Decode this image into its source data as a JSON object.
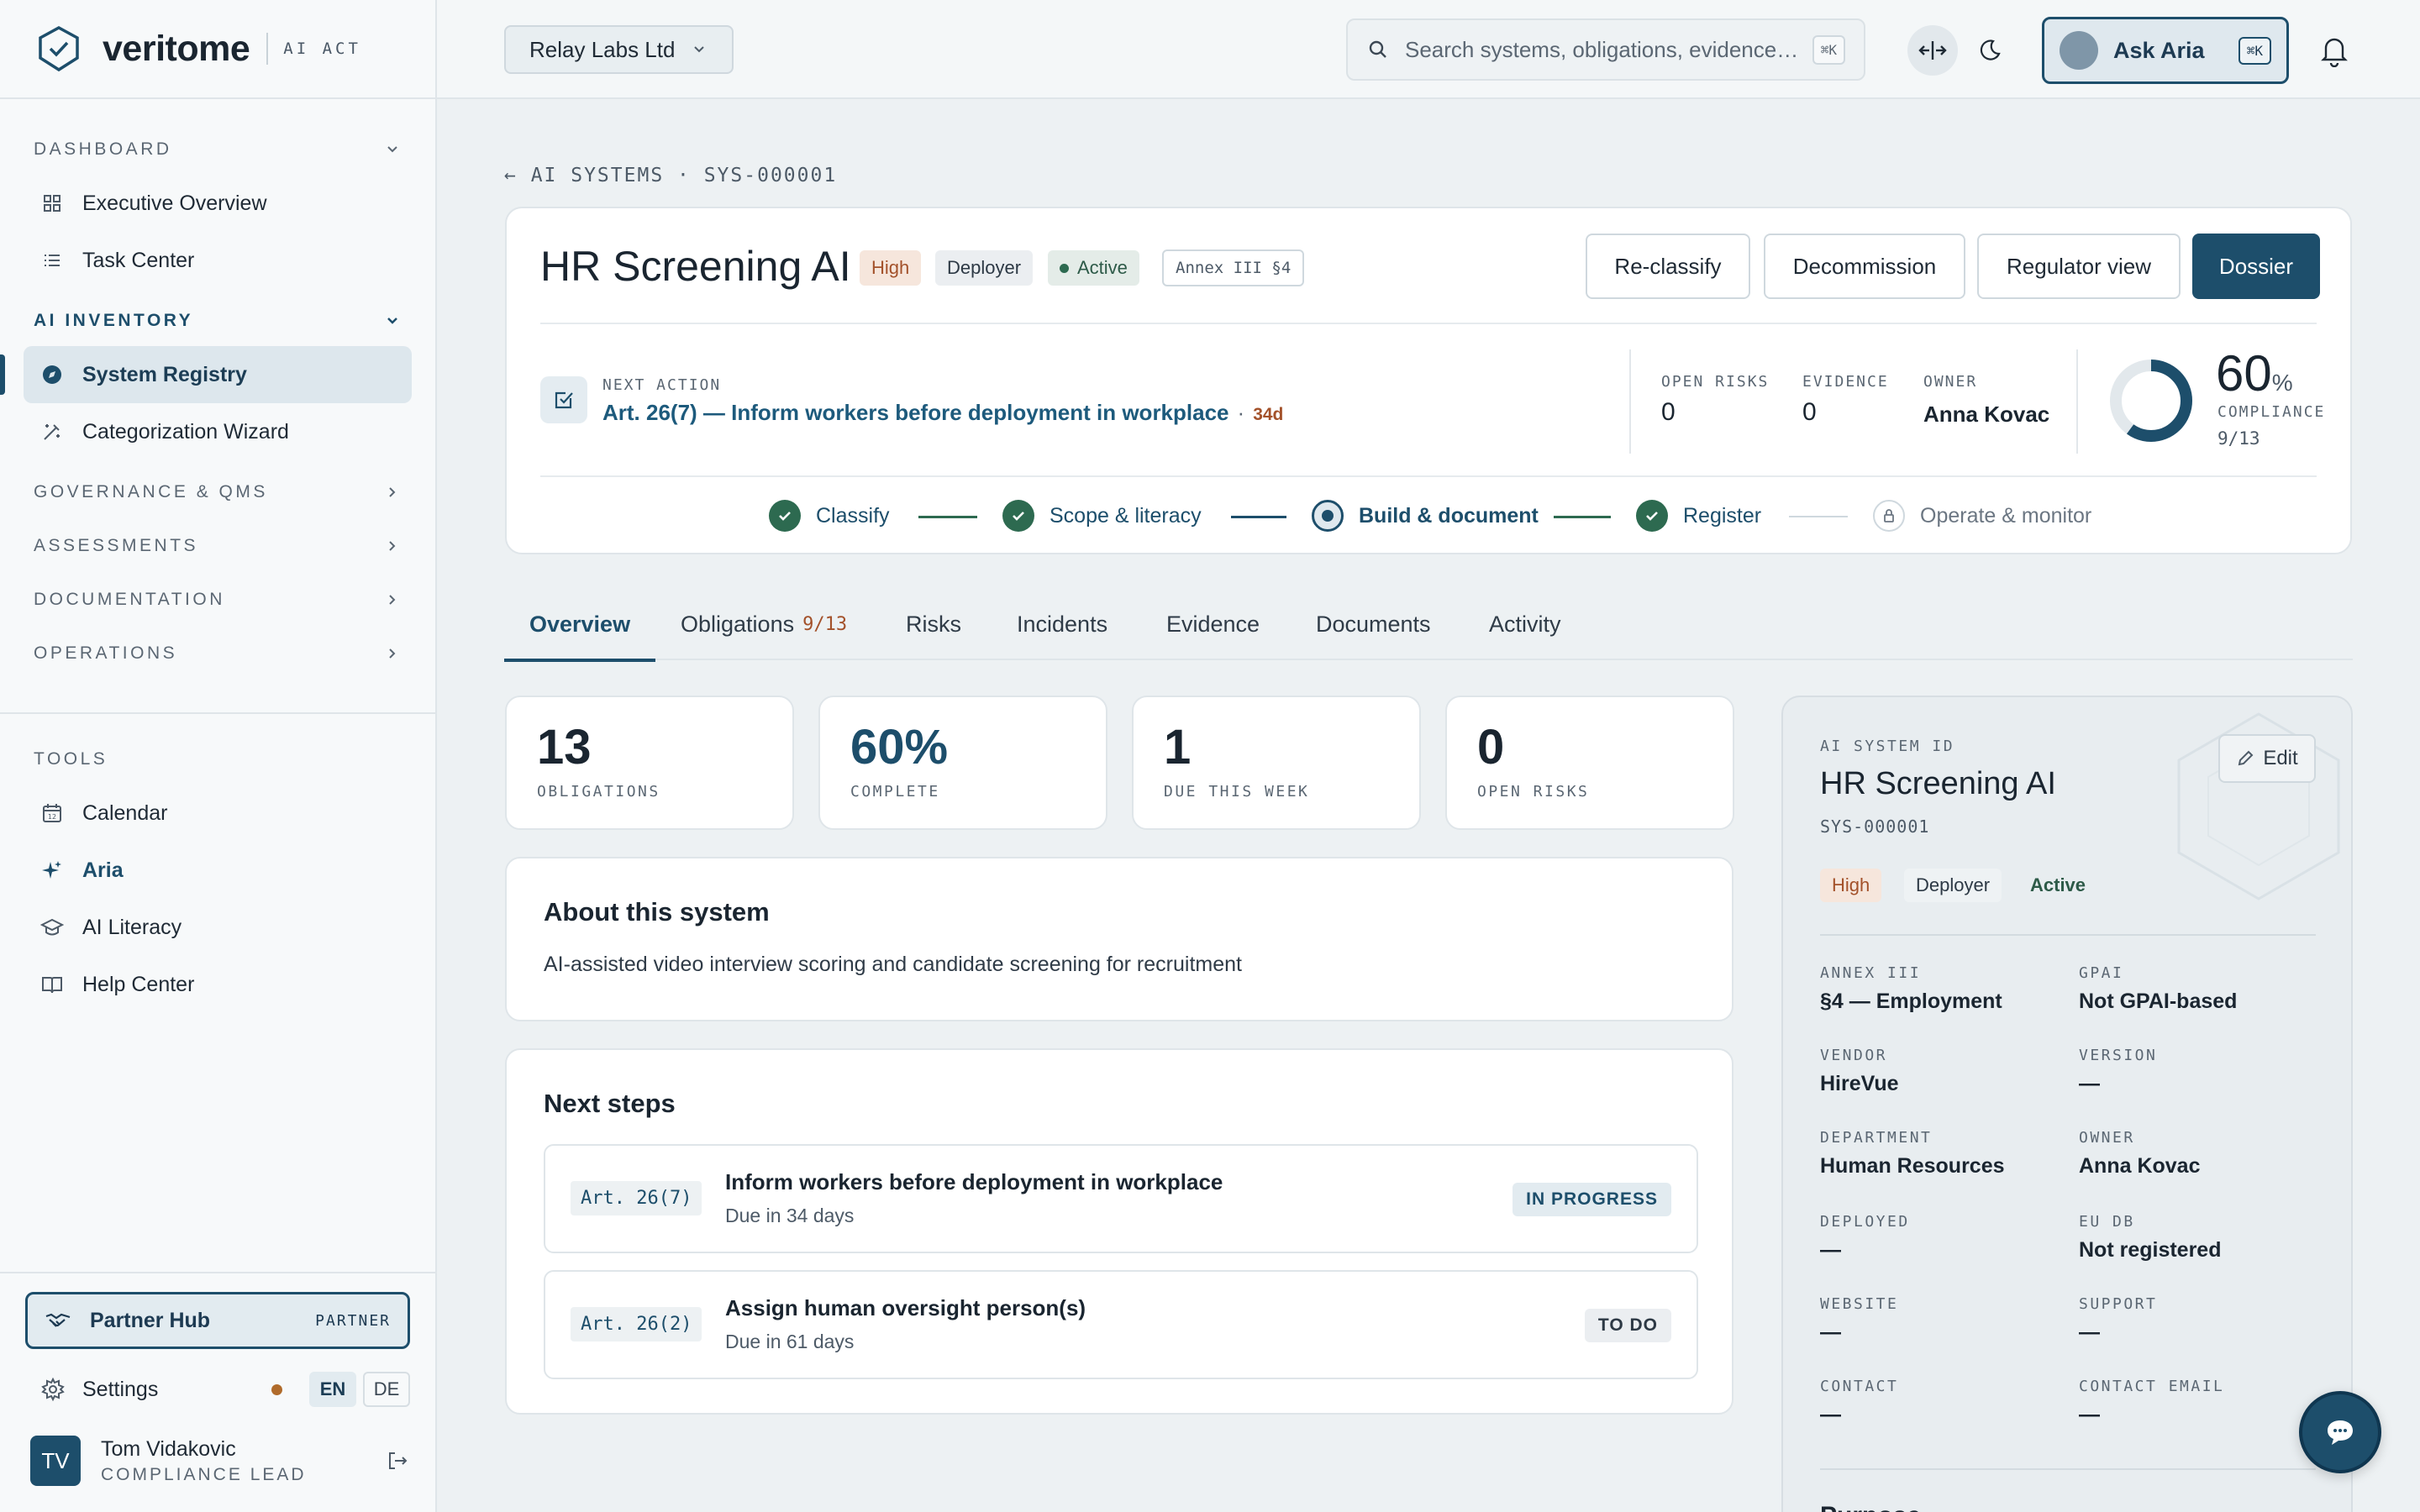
{
  "brand": {
    "name": "veritome",
    "tag": "AI ACT"
  },
  "sidebar": {
    "dashboard": "DASHBOARD",
    "executive_overview": "Executive Overview",
    "task_center": "Task Center",
    "ai_inventory": "AI INVENTORY",
    "system_registry": "System Registry",
    "categorization_wizard": "Categorization Wizard",
    "governance": "GOVERNANCE & QMS",
    "assessments": "ASSESSMENTS",
    "documentation": "DOCUMENTATION",
    "operations": "OPERATIONS",
    "tools": "TOOLS",
    "calendar": "Calendar",
    "aria": "Aria",
    "ai_literacy": "AI Literacy",
    "help_center": "Help Center",
    "partner_hub": "Partner Hub",
    "partner_tag": "PARTNER",
    "settings": "Settings",
    "lang_en": "EN",
    "lang_de": "DE",
    "user_initials": "TV",
    "user_name": "Tom Vidakovic",
    "user_role": "COMPLIANCE LEAD"
  },
  "topbar": {
    "org": "Relay Labs Ltd",
    "search_placeholder": "Search systems, obligations, evidence…",
    "search_kbd": "⌘K",
    "aria_label": "Ask Aria",
    "aria_kbd": "⌘K"
  },
  "breadcrumb": "← AI SYSTEMS · SYS-000001",
  "system": {
    "name": "HR Screening AI",
    "risk": "High",
    "role": "Deployer",
    "status": "Active",
    "annex": "Annex III §4",
    "actions": {
      "reclassify": "Re-classify",
      "decommission": "Decommission",
      "regulator": "Regulator view",
      "dossier": "Dossier"
    },
    "next_action_label": "NEXT ACTION",
    "next_action": "Art. 26(7) — Inform workers before deployment in workplace",
    "next_action_sep": "·",
    "next_action_days": "34d",
    "open_risks_label": "OPEN RISKS",
    "open_risks": "0",
    "evidence_label": "EVIDENCE",
    "evidence": "0",
    "owner_label": "OWNER",
    "owner": "Anna Kovac",
    "compliance_pct": "60",
    "compliance_unit": "%",
    "compliance_fraction": 0.6,
    "compliance_label": "COMPLIANCE",
    "compliance_count": "9/13"
  },
  "steps": [
    "Classify",
    "Scope & literacy",
    "Build & document",
    "Register",
    "Operate & monitor"
  ],
  "tabs": {
    "overview": "Overview",
    "obligations": "Obligations",
    "obligations_count": "9/13",
    "risks": "Risks",
    "incidents": "Incidents",
    "evidence": "Evidence",
    "documents": "Documents",
    "activity": "Activity"
  },
  "kpis": [
    {
      "value": "13",
      "label": "OBLIGATIONS"
    },
    {
      "value": "60%",
      "label": "COMPLETE"
    },
    {
      "value": "1",
      "label": "DUE THIS WEEK"
    },
    {
      "value": "0",
      "label": "OPEN RISKS"
    }
  ],
  "about": {
    "title": "About this system",
    "text": "AI-assisted video interview scoring and candidate screening for recruitment"
  },
  "next_steps": {
    "title": "Next steps",
    "items": [
      {
        "art": "Art. 26(7)",
        "title": "Inform workers before deployment in workplace",
        "due": "Due in 34 days",
        "status": "IN PROGRESS"
      },
      {
        "art": "Art. 26(2)",
        "title": "Assign human oversight person(s)",
        "due": "Due in 61 days",
        "status": "TO DO"
      }
    ]
  },
  "panel": {
    "id_label": "AI SYSTEM ID",
    "title": "HR Screening AI",
    "id": "SYS-000001",
    "edit": "Edit",
    "risk": "High",
    "role": "Deployer",
    "status": "Active",
    "annex_label": "ANNEX III",
    "annex": "§4 — Employment",
    "gpai_label": "GPAI",
    "gpai": "Not GPAI-based",
    "vendor_label": "VENDOR",
    "vendor": "HireVue",
    "version_label": "VERSION",
    "version": "—",
    "department_label": "DEPARTMENT",
    "department": "Human Resources",
    "owner_label": "OWNER",
    "owner": "Anna Kovac",
    "deployed_label": "DEPLOYED",
    "deployed": "—",
    "eudb_label": "EU DB",
    "eudb": "Not registered",
    "website_label": "WEBSITE",
    "website": "—",
    "support_label": "SUPPORT",
    "support": "—",
    "contact_label": "CONTACT",
    "contact": "—",
    "contact_email_label": "CONTACT EMAIL",
    "contact_email": "—",
    "purpose_label": "Purpose"
  },
  "colors": {
    "accent": "#1d4e6b",
    "success": "#2d6a50",
    "warning": "#a3512a"
  }
}
